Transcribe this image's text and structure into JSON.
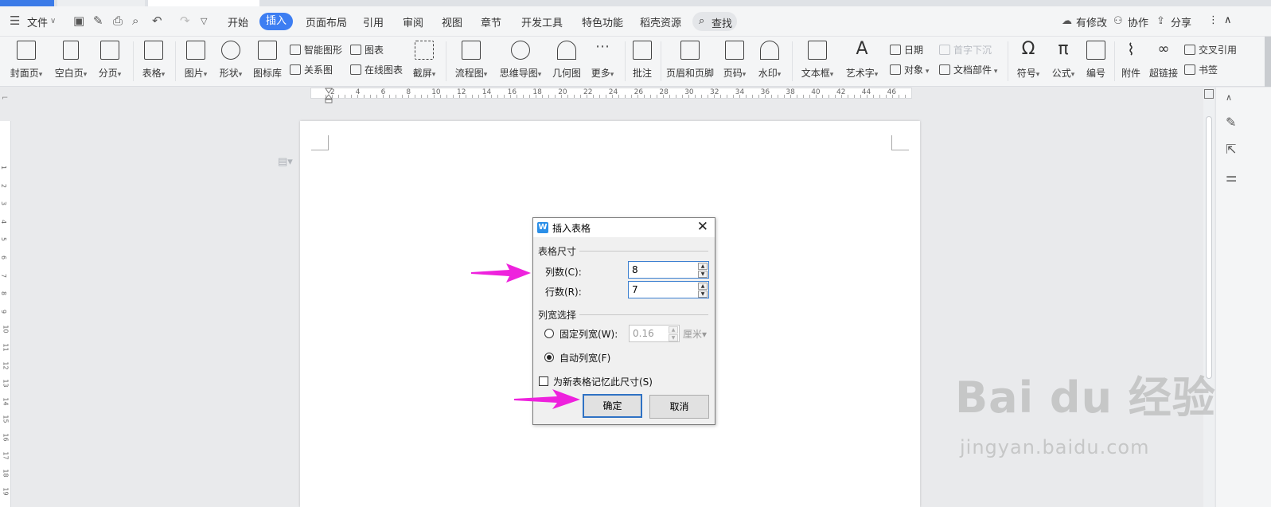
{
  "menubar": {
    "file": "文件",
    "tabs": [
      "开始",
      "插入",
      "页面布局",
      "引用",
      "审阅",
      "视图",
      "章节",
      "开发工具",
      "特色功能",
      "稻壳资源"
    ],
    "active_tab": "插入",
    "search": "查找",
    "modify": "有修改",
    "collaborate": "协作",
    "share": "分享"
  },
  "ribbon": {
    "cover_page": "封面页",
    "blank_page": "空白页",
    "page_break": "分页",
    "table": "表格",
    "picture": "图片",
    "shape": "形状",
    "icon_library": "图标库",
    "smart_graphic": "智能图形",
    "chart": "图表",
    "relation_chart": "关系图",
    "online_chart": "在线图表",
    "screenshot": "截屏",
    "flowchart": "流程图",
    "mindmap": "思维导图",
    "geometry": "几何图",
    "more": "更多",
    "comment": "批注",
    "header_footer": "页眉和页脚",
    "page_number": "页码",
    "watermark": "水印",
    "text_box": "文本框",
    "word_art": "艺术字",
    "date": "日期",
    "object": "对象",
    "drop_cap": "首字下沉",
    "doc_parts": "文档部件",
    "symbol": "符号",
    "formula": "公式",
    "numbering": "编号",
    "attachment": "附件",
    "hyperlink": "超链接",
    "cross_ref": "交叉引用",
    "bookmark": "书签"
  },
  "ruler": {
    "labels": [
      "2",
      "4",
      "6",
      "8",
      "10",
      "12",
      "14",
      "16",
      "18",
      "20",
      "22",
      "24",
      "26",
      "28",
      "30",
      "32",
      "34",
      "36",
      "38",
      "40",
      "42",
      "44",
      "46"
    ]
  },
  "vruler": {
    "labels": [
      "1",
      "2",
      "3",
      "4",
      "5",
      "6",
      "7",
      "8",
      "9",
      "10",
      "11",
      "12",
      "13",
      "14",
      "15",
      "16",
      "17",
      "18",
      "19"
    ]
  },
  "dialog": {
    "title": "插入表格",
    "size_group": "表格尺寸",
    "columns_label": "列数(C):",
    "columns_value": "8",
    "rows_label": "行数(R):",
    "rows_value": "7",
    "width_group": "列宽选择",
    "fixed_width_label": "固定列宽(W):",
    "fixed_width_value": "0.16",
    "fixed_width_unit": "厘米",
    "auto_width_label": "自动列宽(F)",
    "remember_label": "为新表格记忆此尺寸(S)",
    "ok": "确定",
    "cancel": "取消"
  },
  "watermark": {
    "main": "Bai du 经验",
    "sub": "jingyan.baidu.com"
  },
  "colors": {
    "accent": "#3d7ef2",
    "arrow": "#ee22dd"
  }
}
